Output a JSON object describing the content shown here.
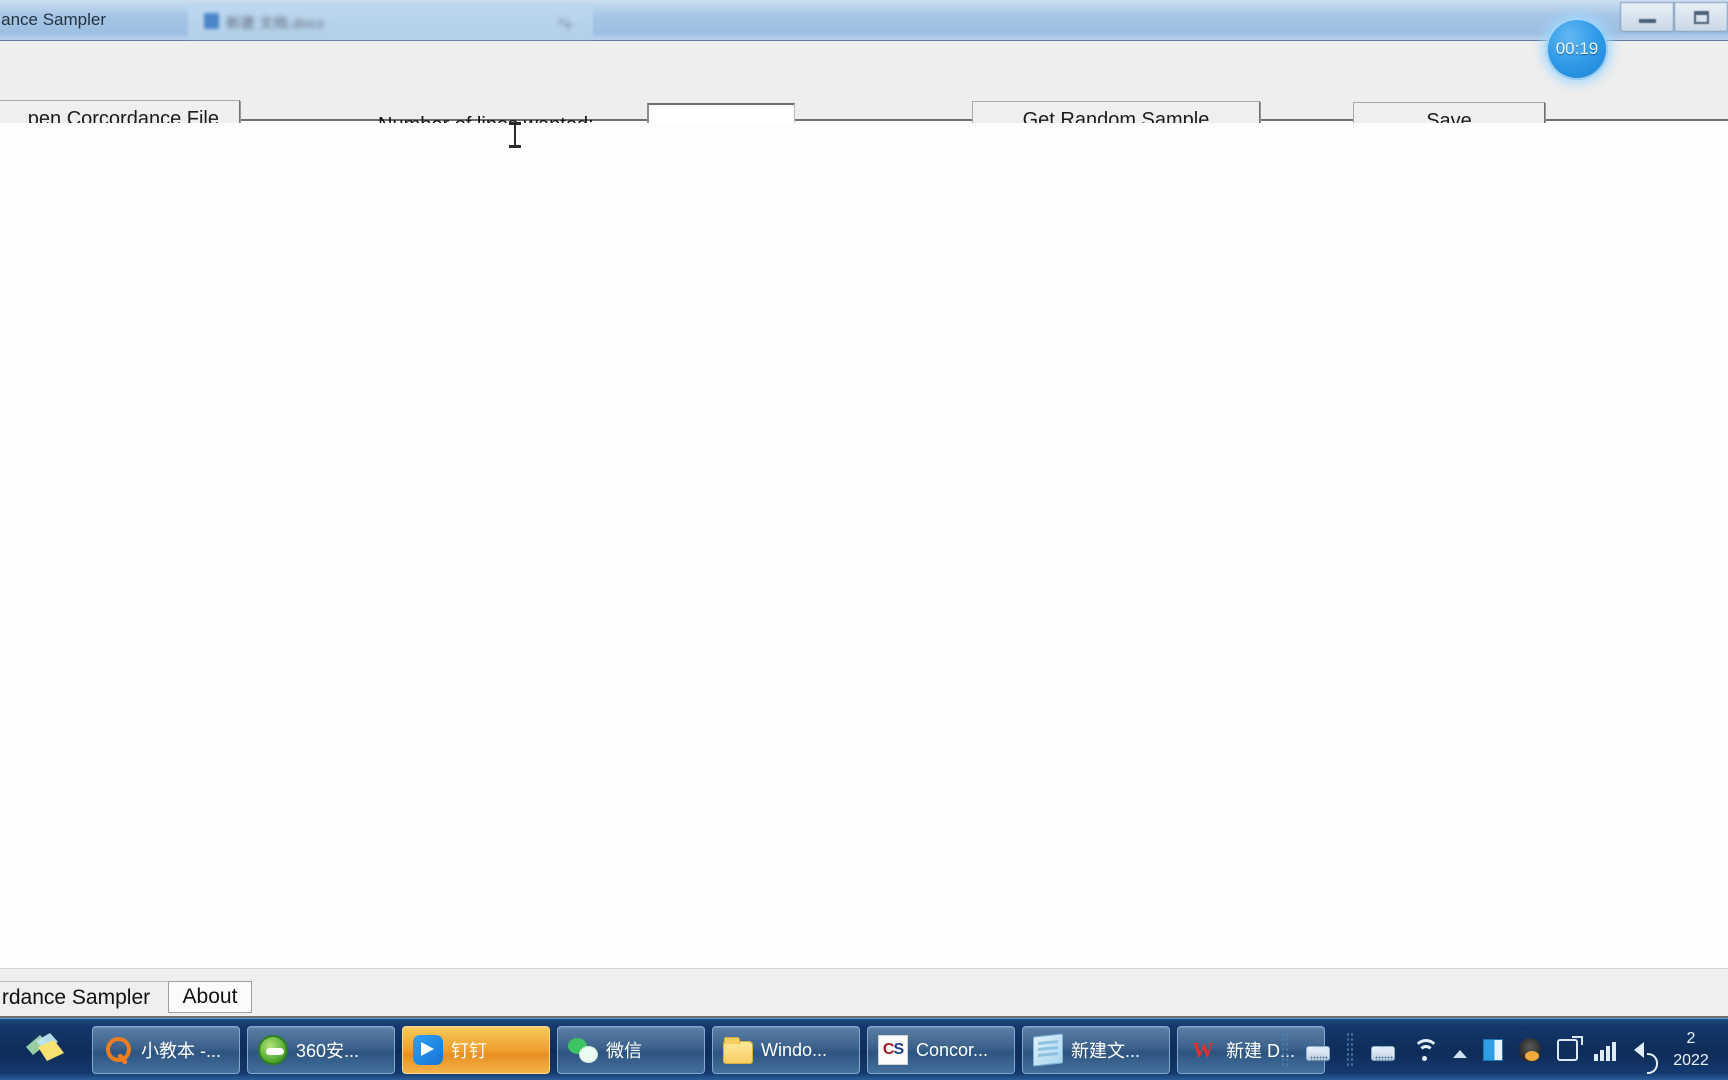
{
  "window": {
    "title": "rdance Sampler",
    "background_tab_title": "新建  文档.docx",
    "minimize_label": "Minimize",
    "maximize_label": "Maximize"
  },
  "timer": {
    "value": "00:19",
    "color": "#2f9ae8"
  },
  "toolbar": {
    "open_file_label": "pen Corcordance File",
    "lines_label": "Number of lines wanted:",
    "lines_value": "",
    "lines_placeholder": "",
    "get_sample_label": "Get Random Sample",
    "save_label": "Save"
  },
  "tabs": [
    {
      "label": "rdance Sampler",
      "selected": true
    },
    {
      "label": "About",
      "selected": false
    }
  ],
  "taskbar": {
    "start_label": "Start",
    "items": [
      {
        "label": "小教本 -...",
        "icon": "magnifier-icon",
        "highlight": false
      },
      {
        "label": "360安...",
        "icon": "browser-icon",
        "highlight": false
      },
      {
        "label": "钉钉",
        "icon": "dingtalk-icon",
        "highlight": true
      },
      {
        "label": "微信",
        "icon": "wechat-icon",
        "highlight": false
      },
      {
        "label": "Windo...",
        "icon": "folder-icon",
        "highlight": false
      },
      {
        "label": "Concor...",
        "icon": "cs-icon",
        "highlight": false
      },
      {
        "label": "新建文...",
        "icon": "notepad-icon",
        "highlight": false
      },
      {
        "label": "新建 D...",
        "icon": "wps-icon",
        "highlight": false
      }
    ],
    "tray": [
      "keyboard-icon",
      "keyboard-icon",
      "wifi-icon",
      "show-hidden-icons-icon",
      "book-icon",
      "qq-icon",
      "plug-icon",
      "signal-bars-icon",
      "volume-icon"
    ],
    "clock_time": "2",
    "clock_date": "2022"
  },
  "colors": {
    "titlebar": "#a7c6e6",
    "toolbar": "#eeeeee",
    "canvas": "#fdfdfd",
    "taskbar": "#14386a",
    "accent": "#2f9ae8"
  }
}
